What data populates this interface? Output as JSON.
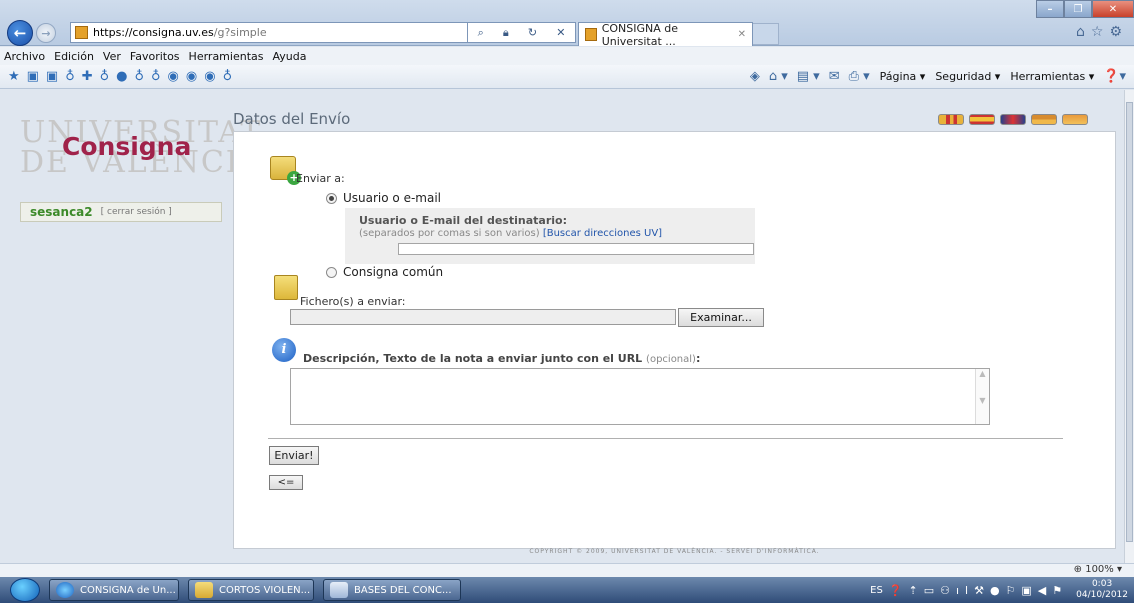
{
  "browser": {
    "url_host": "https://consigna.uv.es",
    "url_path": "/g?simple",
    "tab_title": "CONSIGNA de Universitat ...",
    "menu": [
      "Archivo",
      "Edición",
      "Ver",
      "Favoritos",
      "Herramientas",
      "Ayuda"
    ],
    "commands": [
      "Página ▾",
      "Seguridad ▾",
      "Herramientas ▾"
    ],
    "zoom": "100%"
  },
  "sidebar": {
    "logo_bg": "UNIVERSITAT\nDE VALÈNCIA",
    "logo_fg": "Consigna",
    "username": "sesanca2",
    "logout": "[ cerrar sesión ]"
  },
  "page": {
    "title": "Datos del Envío",
    "send_to_label": "Enviar a:",
    "option_user": "Usuario o e-mail",
    "option_common": "Consigna común",
    "recipient_title": "Usuario o E-mail del destinatario:",
    "recipient_hint": "(separados por comas si son varios)",
    "recipient_link": "[Buscar direcciones UV]",
    "recipient_value": "",
    "files_label": "Fichero(s) a enviar:",
    "file_value": "",
    "browse_label": "Examinar...",
    "desc_label": "Descripción, Texto de la nota a enviar junto con el URL",
    "desc_optional": "(opcional)",
    "desc_suffix": ":",
    "desc_value": "",
    "submit_label": "Enviar!",
    "back_label": "<=",
    "footer": "COPYRIGHT © 2009, UNIVERSITAT DE VALÈNCIA. - SERVEI D'INFORMÀTICA."
  },
  "taskbar": {
    "items": [
      "CONSIGNA de Un...",
      "CORTOS VIOLEN...",
      "BASES DEL CONC..."
    ],
    "lang": "ES",
    "time": "0:03",
    "date": "04/10/2012"
  },
  "colors": {
    "brand": "#a0224a",
    "user": "#3c8a2a",
    "link": "#2255aa"
  }
}
